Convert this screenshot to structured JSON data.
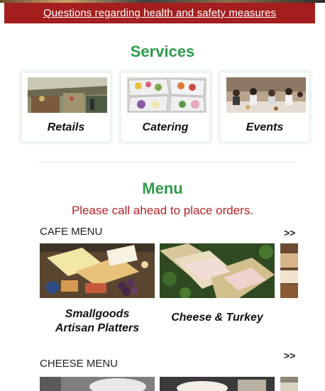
{
  "notice": {
    "link_text": "Questions regarding health and safety measures"
  },
  "services": {
    "title": "Services",
    "cards": [
      {
        "label": "Retails",
        "image": "market-stall-photo"
      },
      {
        "label": "Catering",
        "image": "catering-platter-photo"
      },
      {
        "label": "Events",
        "image": "event-guests-photo"
      }
    ]
  },
  "menu": {
    "title": "Menu",
    "note": "Please call ahead to place orders.",
    "more_label": ">>",
    "sections": [
      {
        "title": "CAFE MENU",
        "items": [
          {
            "label_line1": "Smallgoods",
            "label_line2": "Artisan Platters",
            "image": "artisan-platter-photo"
          },
          {
            "label_line1": "Cheese & Turkey",
            "label_line2": "",
            "image": "turkey-sandwich-photo"
          },
          {
            "label_line1": "",
            "label_line2": "",
            "image": "partial-item-photo"
          }
        ]
      },
      {
        "title": "CHEESE MENU",
        "items": [
          {
            "image": "cheese-photo-1"
          },
          {
            "image": "cheese-photo-2"
          },
          {
            "image": "cheese-photo-3"
          }
        ]
      }
    ]
  },
  "colors": {
    "notice_bg": "#a41e1e",
    "title_green": "#2e9a4a",
    "note_red": "#b5232a"
  }
}
